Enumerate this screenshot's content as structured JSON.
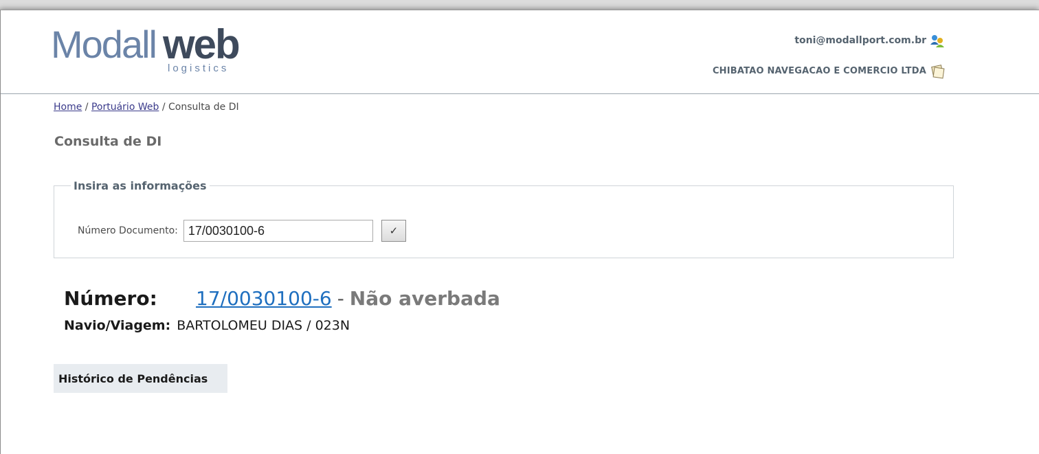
{
  "logo": {
    "part1": "Modall",
    "part2": "web",
    "subtitle": "logistics"
  },
  "header": {
    "user_email": "toni@modallport.com.br",
    "company": "CHIBATAO NAVEGACAO E COMERCIO LTDA",
    "user_icon": "users-icon",
    "company_icon": "document-icon"
  },
  "breadcrumb": {
    "home": "Home",
    "sep1": "/",
    "section": "Portuário Web",
    "sep2": "/",
    "current": "Consulta de DI"
  },
  "page": {
    "title": "Consulta de DI"
  },
  "form": {
    "legend": "Insira as informações",
    "label": "Número Documento:",
    "value": "17/0030100-6",
    "submit_label": "✓"
  },
  "result": {
    "numero_label": "Número:",
    "numero_value": "17/0030100-6",
    "separator": "-",
    "status": "Não averbada",
    "navio_label": "Navio/Viagem:",
    "navio_value": "BARTOLOMEU DIAS / 023N"
  },
  "tabs": {
    "history": "Histórico de Pendências"
  },
  "colors": {
    "accent_link": "#1f6fbf",
    "logo_light": "#6b84a8",
    "logo_dark": "#3e4a5c"
  }
}
